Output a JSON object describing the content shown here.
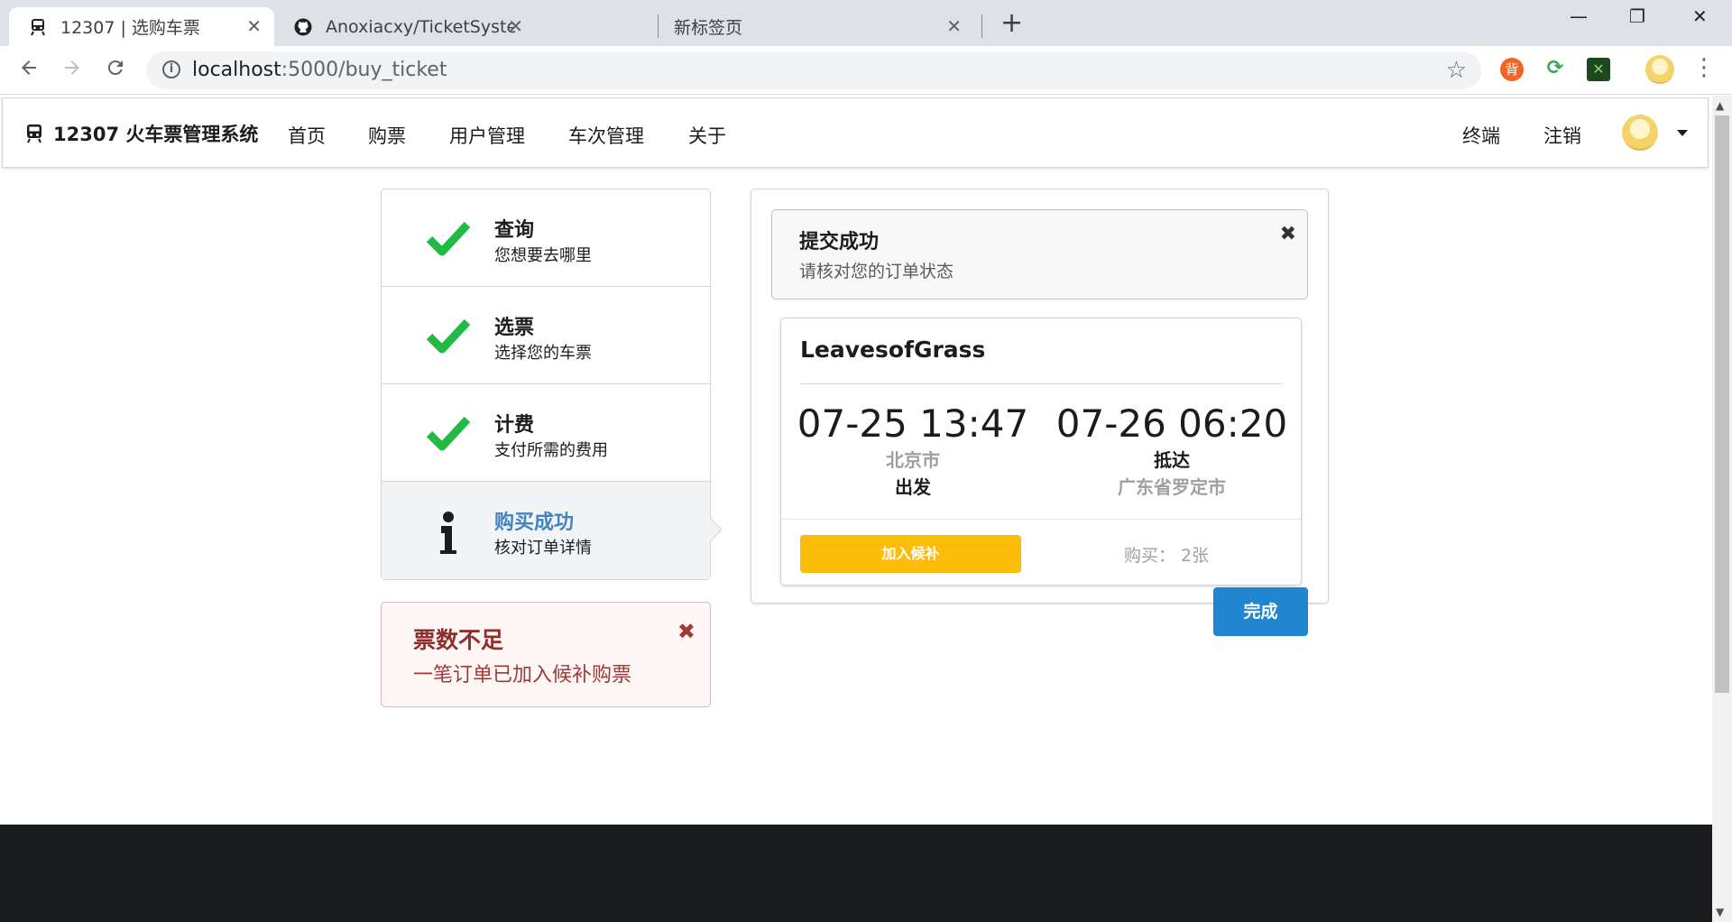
{
  "browser": {
    "tabs": [
      {
        "title": "12307 | 选购车票",
        "active": true
      },
      {
        "title": "Anoxiacxy/TicketSystem: 2020",
        "active": false
      },
      {
        "title": "新标签页",
        "active": false
      }
    ],
    "new_tab": "+",
    "window_controls": {
      "minimize": "—",
      "restore": "❐",
      "close": "✕"
    },
    "url": {
      "host": "localhost",
      "path": ":5000/buy_ticket"
    },
    "icons": {
      "back": "arrow-left-icon",
      "forward": "arrow-right-icon",
      "reload": "reload-icon",
      "info": "info-icon",
      "star": "star-icon",
      "menu": "kebab-menu-icon"
    },
    "extensions": [
      {
        "name": "extension-orange",
        "color": "#f26522",
        "glyph": "背"
      },
      {
        "name": "extension-green",
        "color": "#34a853",
        "glyph": "⟳"
      },
      {
        "name": "extension-dark",
        "color": "#1e4620",
        "glyph": "✕"
      },
      {
        "name": "profile-avatar",
        "color": "#f4d36a",
        "glyph": ""
      }
    ]
  },
  "nav": {
    "brand": "12307 火车票管理系统",
    "items": [
      "首页",
      "购票",
      "用户管理",
      "车次管理",
      "关于"
    ],
    "right": [
      "终端",
      "注销"
    ]
  },
  "steps": [
    {
      "title": "查询",
      "desc": "您想要去哪里",
      "icon": "check-icon",
      "state": "completed"
    },
    {
      "title": "选票",
      "desc": "选择您的车票",
      "icon": "check-icon",
      "state": "completed"
    },
    {
      "title": "计费",
      "desc": "支付所需的费用",
      "icon": "check-icon",
      "state": "completed"
    },
    {
      "title": "购买成功",
      "desc": "核对订单详情",
      "icon": "info-icon",
      "state": "active"
    }
  ],
  "error_message": {
    "header": "票数不足",
    "text": "一笔订单已加入候补购票",
    "close": "✖"
  },
  "success_message": {
    "header": "提交成功",
    "text": "请核对您的订单状态",
    "close": "✖"
  },
  "order": {
    "train": "LeavesofGrass",
    "departure": {
      "time": "07-25 13:47",
      "station": "北京市",
      "label": "出发"
    },
    "arrival": {
      "time": "07-26 06:20",
      "label": "抵达",
      "station": "广东省罗定市"
    },
    "waitlist_button": "加入候补",
    "quantity": "购买： 2张"
  },
  "done_button": "完成",
  "colors": {
    "check": "#21ba45",
    "primary": "#2185d0",
    "warning": "#fbbd08",
    "error": "#9f3a38",
    "active_step": "#4183c4"
  }
}
